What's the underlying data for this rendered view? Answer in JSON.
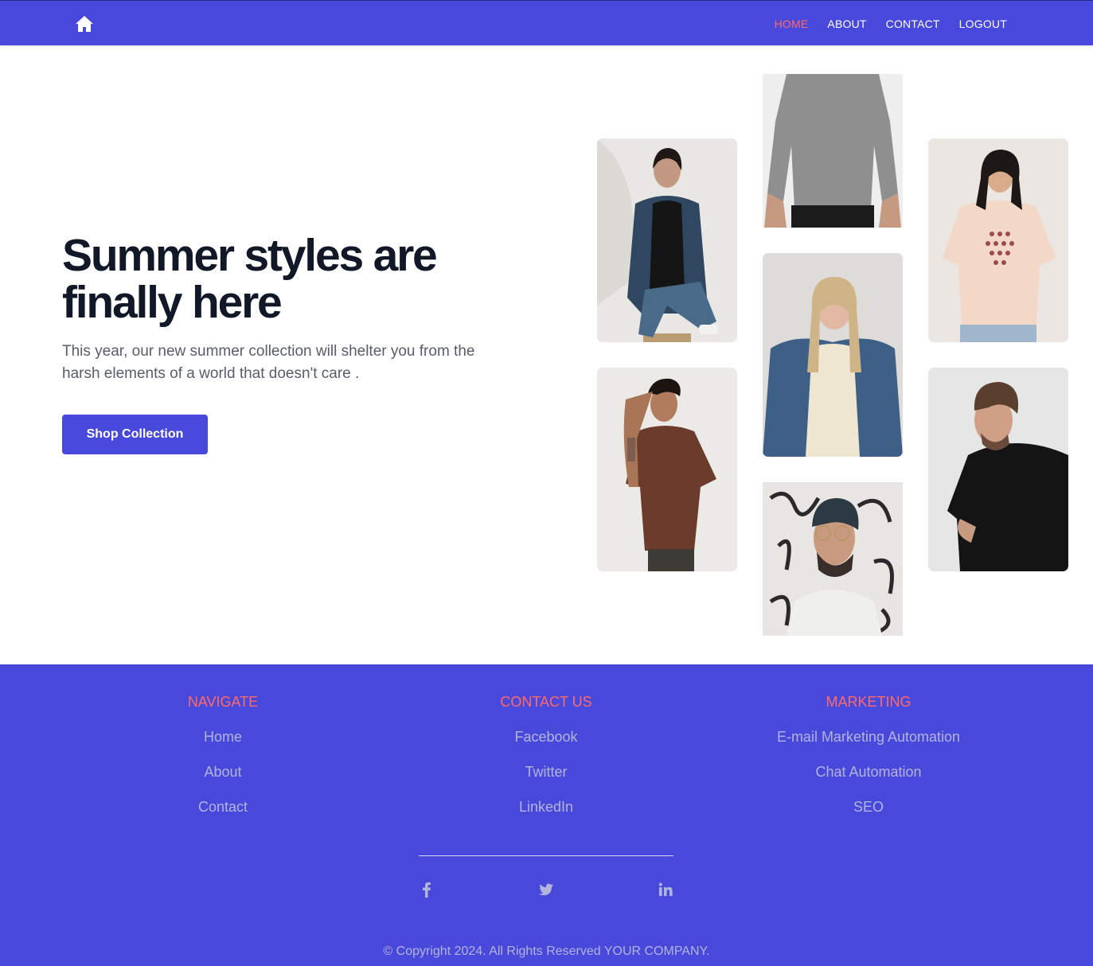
{
  "nav": {
    "home_icon": "home-icon",
    "links": [
      {
        "label": "HOME",
        "active": true
      },
      {
        "label": "ABOUT",
        "active": false
      },
      {
        "label": "CONTACT",
        "active": false
      },
      {
        "label": "LOGOUT",
        "active": false
      }
    ]
  },
  "hero": {
    "title": "Summer styles are finally here",
    "text": "This year, our new summer collection will shelter you from the harsh elements of a world that doesn't care .",
    "button_label": "Shop Collection"
  },
  "gallery": {
    "photos": [
      "woman-denim-jacket-photo",
      "man-brown-tshirt-photo",
      "grey-tshirt-photo",
      "blonde-woman-denim-photo",
      "man-beanie-glasses-photo",
      "woman-pink-tshirt-photo",
      "man-black-tshirt-photo"
    ]
  },
  "footer": {
    "columns": [
      {
        "title": "NAVIGATE",
        "links": [
          "Home",
          "About",
          "Contact"
        ]
      },
      {
        "title": "CONTACT US",
        "links": [
          "Facebook",
          "Twitter",
          "LinkedIn"
        ]
      },
      {
        "title": "MARKETING",
        "links": [
          "E-mail Marketing Automation",
          "Chat Automation",
          "SEO"
        ]
      }
    ],
    "social_icons": [
      "facebook-icon",
      "twitter-icon",
      "linkedin-icon"
    ],
    "copyright": "© Copyright 2024. All Rights Reserved YOUR COMPANY."
  },
  "colors": {
    "brand": "#4848db",
    "accent": "#ff6a6a",
    "heading": "#111827",
    "footer_link": "#b3b4dc"
  }
}
